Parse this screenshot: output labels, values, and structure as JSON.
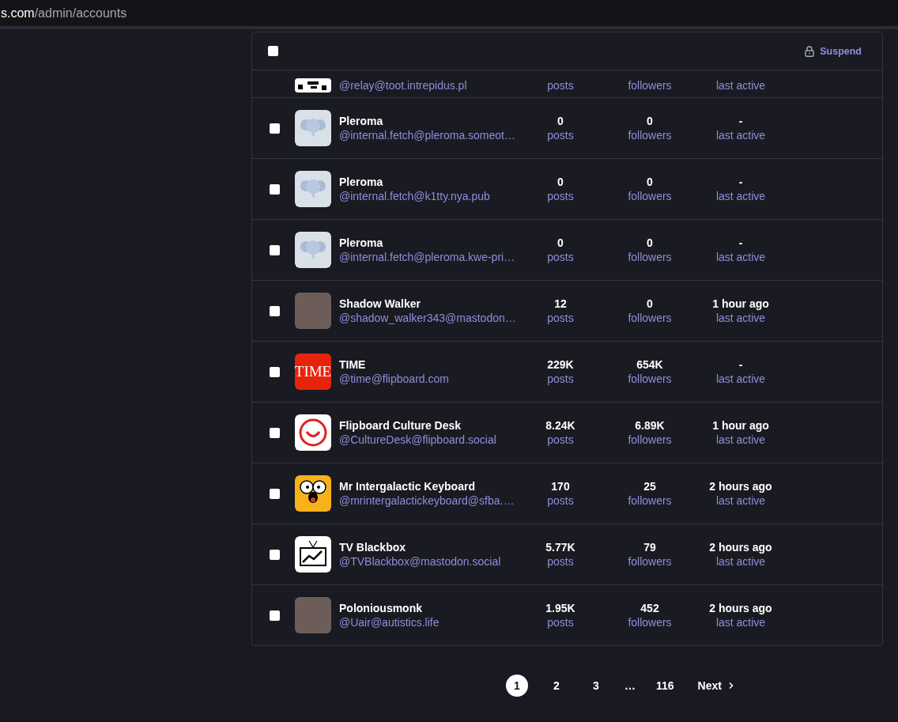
{
  "address_bar": {
    "host": "s.com",
    "path": "/admin/accounts"
  },
  "table": {
    "header": {
      "checked": false,
      "action": "Suspend"
    },
    "partial_row": {
      "kind": "pixel",
      "handle": "@relay@toot.intrepidus.pl",
      "posts_label": "posts",
      "followers_label": "followers",
      "active_label": "last active"
    },
    "rows": [
      {
        "checked": false,
        "kind": "elephant",
        "name": "Pleroma",
        "handle": "@internal.fetch@pleroma.someot…",
        "posts": "0",
        "posts_label": "posts",
        "followers": "0",
        "followers_label": "followers",
        "active": "-",
        "active_label": "last active"
      },
      {
        "checked": false,
        "kind": "elephant",
        "name": "Pleroma",
        "handle": "@internal.fetch@k1tty.nya.pub",
        "posts": "0",
        "posts_label": "posts",
        "followers": "0",
        "followers_label": "followers",
        "active": "-",
        "active_label": "last active"
      },
      {
        "checked": false,
        "kind": "elephant",
        "name": "Pleroma",
        "handle": "@internal.fetch@pleroma.kwe-pri…",
        "posts": "0",
        "posts_label": "posts",
        "followers": "0",
        "followers_label": "followers",
        "active": "-",
        "active_label": "last active"
      },
      {
        "checked": false,
        "kind": "photo",
        "name": "Shadow Walker",
        "handle": "@shadow_walker343@mastodon…",
        "posts": "12",
        "posts_label": "posts",
        "followers": "0",
        "followers_label": "followers",
        "active": "1 hour ago",
        "active_label": "last active"
      },
      {
        "checked": false,
        "kind": "wordmark",
        "logo_text": "TIME",
        "name": "TIME",
        "handle": "@time@flipboard.com",
        "posts": "229K",
        "posts_label": "posts",
        "followers": "654K",
        "followers_label": "followers",
        "active": "-",
        "active_label": "last active"
      },
      {
        "checked": false,
        "kind": "smile",
        "name": "Flipboard Culture Desk",
        "handle": "@CultureDesk@flipboard.social",
        "posts": "8.24K",
        "posts_label": "posts",
        "followers": "6.89K",
        "followers_label": "followers",
        "active": "1 hour ago",
        "active_label": "last active"
      },
      {
        "checked": false,
        "kind": "cartoon",
        "name": "Mr Intergalactic Keyboard",
        "handle": "@mrintergalactickeyboard@sfba.…",
        "posts": "170",
        "posts_label": "posts",
        "followers": "25",
        "followers_label": "followers",
        "active": "2 hours ago",
        "active_label": "last active"
      },
      {
        "checked": false,
        "kind": "tv",
        "name": "TV Blackbox",
        "handle": "@TVBlackbox@mastodon.social",
        "posts": "5.77K",
        "posts_label": "posts",
        "followers": "79",
        "followers_label": "followers",
        "active": "2 hours ago",
        "active_label": "last active"
      },
      {
        "checked": false,
        "kind": "photo",
        "name": "Poloniousmonk",
        "handle": "@Uair@autistics.life",
        "posts": "1.95K",
        "posts_label": "posts",
        "followers": "452",
        "followers_label": "followers",
        "active": "2 hours ago",
        "active_label": "last active"
      }
    ]
  },
  "pagination": {
    "pages": [
      {
        "label": "1",
        "selected": true
      },
      {
        "label": "2",
        "selected": false
      },
      {
        "label": "3",
        "selected": false
      }
    ],
    "ellipsis": "…",
    "last": {
      "label": "116",
      "selected": false
    },
    "next": "Next"
  }
}
